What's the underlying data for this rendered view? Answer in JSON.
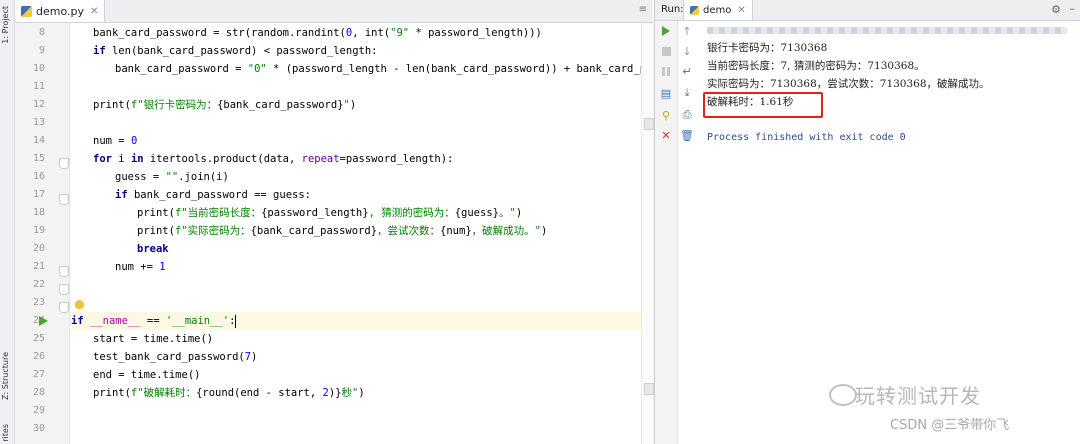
{
  "sidebar": {
    "project_tab": "1: Project",
    "structure_tab": "Z: Structure",
    "favorites_tab": "rites"
  },
  "editor": {
    "file_tab": "demo.py",
    "line_numbers": [
      "8",
      "9",
      "10",
      "11",
      "12",
      "13",
      "14",
      "15",
      "16",
      "17",
      "18",
      "19",
      "20",
      "21",
      "22",
      "23",
      "24",
      "25",
      "26",
      "27",
      "28",
      "29",
      "30"
    ],
    "current_line": "24"
  },
  "run": {
    "label": "Run:",
    "tab_name": "demo",
    "output": [
      "银行卡密码为：7130368",
      "当前密码长度：7, 猜测的密码为：7130368。",
      "实际密码为：7130368，尝试次数：7130368，破解成功。",
      "破解耗时：1.61秒",
      "Process finished with exit code 0"
    ],
    "highlight_color": "#e0241c"
  },
  "watermark": {
    "brand": "玩转测试开发",
    "credit": "CSDN @三爷带你飞"
  },
  "icons": [
    "python-file-icon",
    "play-icon",
    "stop-icon",
    "pause-icon",
    "rerun-icon",
    "pin-icon",
    "close-icon",
    "gear-icon",
    "lightbulb-icon"
  ]
}
